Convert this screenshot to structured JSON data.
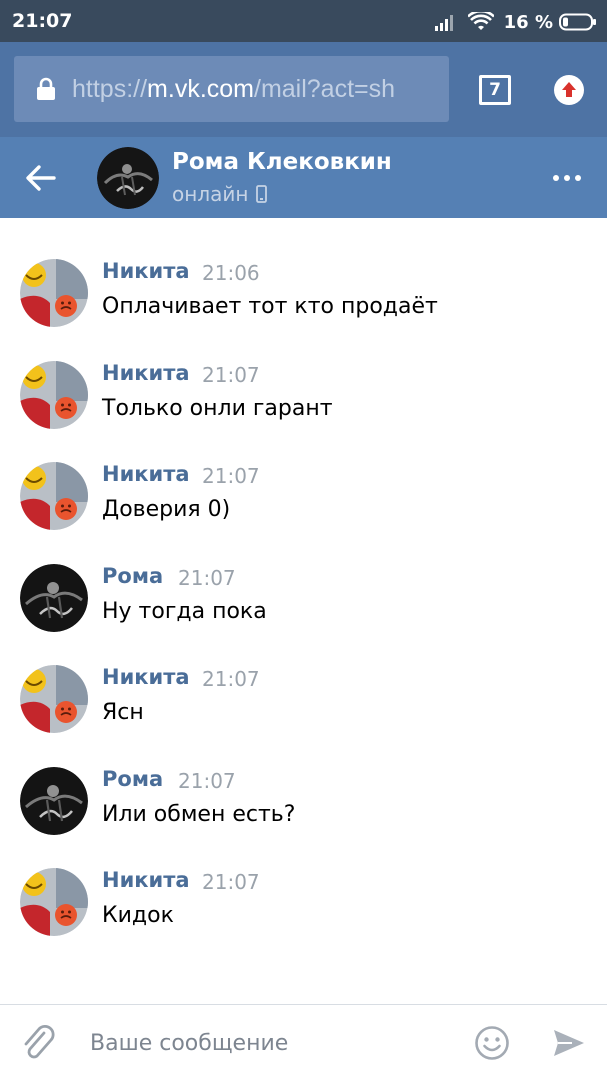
{
  "status_bar": {
    "time": "21:07",
    "battery": "16 %",
    "icons": [
      "signal-icon",
      "wifi-icon",
      "battery-icon"
    ]
  },
  "browser": {
    "url_prefix": "https://",
    "url_host": "m.vk.com",
    "url_path": "/mail?act=sh",
    "tab_count": "7",
    "icons": [
      "lock-icon",
      "tabs-icon",
      "upload-icon"
    ]
  },
  "header": {
    "name": "Рома Клековкин",
    "status": "онлайн",
    "icons": [
      "back-arrow-icon",
      "phone-icon",
      "more-icon"
    ],
    "colors": {
      "header_bg": "#5580b4",
      "browser_bg": "#4e73a4",
      "status_bar_bg": "#394a5d"
    }
  },
  "messages": [
    {
      "author": "Никита",
      "time": "21:06",
      "text": "Оплачивает тот кто продаёт"
    },
    {
      "author": "Никита",
      "time": "21:07",
      "text": "Только онли гарант"
    },
    {
      "author": "Никита",
      "time": "21:07",
      "text": "Доверия 0)"
    },
    {
      "author": "Рома",
      "time": "21:07",
      "text": "Ну тогда пока"
    },
    {
      "author": "Никита",
      "time": "21:07",
      "text": "Ясн"
    },
    {
      "author": "Рома",
      "time": "21:07",
      "text": "Или обмен есть?"
    },
    {
      "author": "Никита",
      "time": "21:07",
      "text": "Кидок"
    }
  ],
  "compose": {
    "placeholder": "Ваше сообщение",
    "icons": [
      "paperclip-icon",
      "emoji-icon",
      "send-icon"
    ]
  },
  "colors": {
    "author_name": "#4a6d98",
    "time": "#9aa2ab"
  }
}
